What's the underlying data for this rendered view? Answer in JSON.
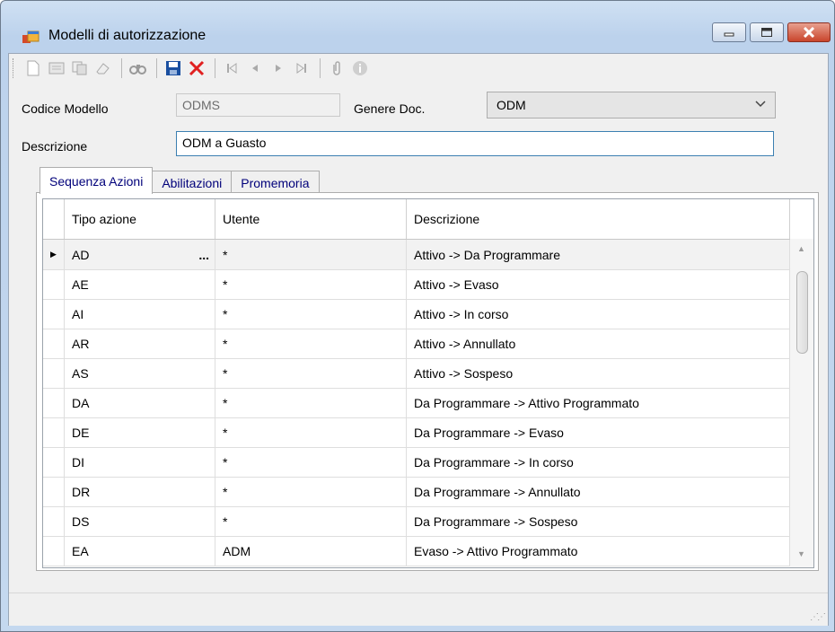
{
  "window": {
    "title": "Modelli di autorizzazione"
  },
  "toolbar": {
    "buttons": [
      "new-doc-icon",
      "print-preview-icon",
      "copy-icon",
      "eraser-icon",
      "find-icon",
      "save-icon",
      "delete-icon",
      "first-record-icon",
      "prev-record-icon",
      "next-record-icon",
      "last-record-icon",
      "attach-icon",
      "info-icon"
    ]
  },
  "form": {
    "codice_label": "Codice Modello",
    "codice_value": "ODMS",
    "genere_label": "Genere Doc.",
    "genere_value": "ODM",
    "descrizione_label": "Descrizione",
    "descrizione_value": "ODM a Guasto"
  },
  "tabs": [
    {
      "label": "Sequenza Azioni"
    },
    {
      "label": "Abilitazioni"
    },
    {
      "label": "Promemoria"
    }
  ],
  "grid": {
    "headers": [
      "Tipo azione",
      "Utente",
      "Descrizione"
    ],
    "rows": [
      {
        "tipo": "AD",
        "utente": "*",
        "descrizione": "Attivo -> Da Programmare",
        "ellipsis": "..."
      },
      {
        "tipo": "AE",
        "utente": "*",
        "descrizione": "Attivo -> Evaso"
      },
      {
        "tipo": "AI",
        "utente": "*",
        "descrizione": "Attivo -> In corso"
      },
      {
        "tipo": "AR",
        "utente": "*",
        "descrizione": "Attivo -> Annullato"
      },
      {
        "tipo": "AS",
        "utente": "*",
        "descrizione": "Attivo -> Sospeso"
      },
      {
        "tipo": "DA",
        "utente": "*",
        "descrizione": "Da Programmare -> Attivo Programmato"
      },
      {
        "tipo": "DE",
        "utente": "*",
        "descrizione": "Da Programmare -> Evaso"
      },
      {
        "tipo": "DI",
        "utente": "*",
        "descrizione": "Da Programmare -> In corso"
      },
      {
        "tipo": "DR",
        "utente": "*",
        "descrizione": "Da Programmare -> Annullato"
      },
      {
        "tipo": "DS",
        "utente": "*",
        "descrizione": "Da Programmare -> Sospeso"
      },
      {
        "tipo": "EA",
        "utente": "ADM",
        "descrizione": "Evaso -> Attivo Programmato"
      }
    ]
  },
  "colors": {
    "save": "#1a4fa0",
    "delete": "#e02020",
    "accent": "#3c7fb1"
  }
}
